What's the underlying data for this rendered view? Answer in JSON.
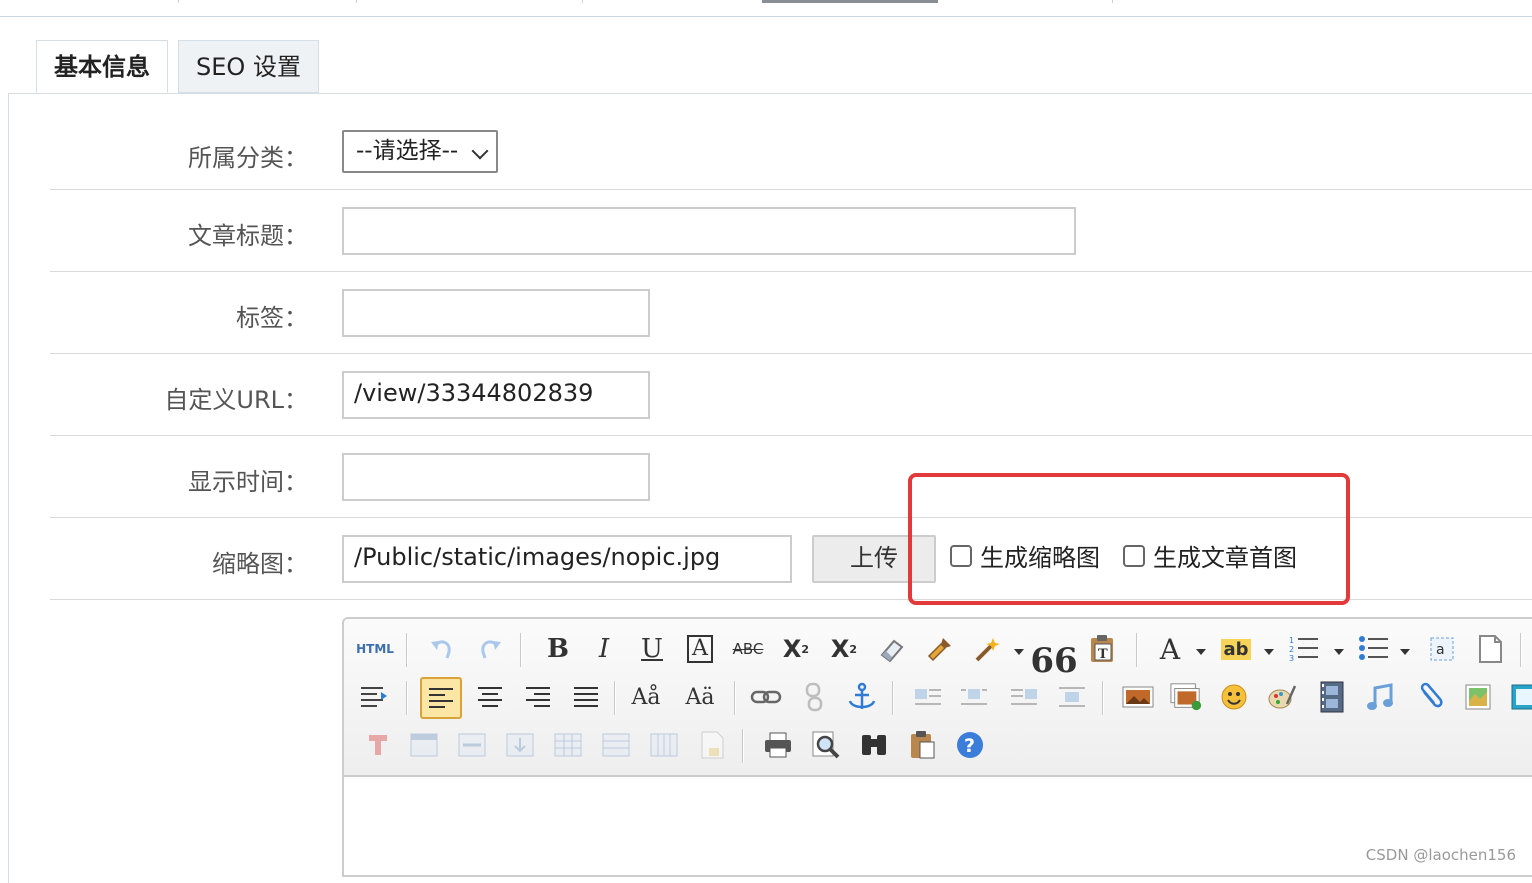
{
  "tabs": [
    {
      "label": "基本信息",
      "active": true
    },
    {
      "label": "SEO 设置",
      "active": false
    }
  ],
  "form": {
    "category": {
      "label": "所属分类：",
      "selected": "--请选择--"
    },
    "title": {
      "label": "文章标题：",
      "value": ""
    },
    "tags": {
      "label": "标签：",
      "value": ""
    },
    "custom_url": {
      "label": "自定义URL：",
      "value": "/view/33344802839"
    },
    "display_time": {
      "label": "显示时间：",
      "value": ""
    },
    "thumbnail": {
      "label": "缩略图：",
      "value": "/Public/static/images/nopic.jpg",
      "upload_label": "上传",
      "options": [
        {
          "label": "生成缩略图",
          "checked": false
        },
        {
          "label": "生成文章首图",
          "checked": false
        }
      ]
    }
  },
  "editor": {
    "toolbar_rows": [
      [
        "html-icon",
        "undo-icon",
        "redo-icon",
        "bold-icon",
        "italic-icon",
        "underline-icon",
        "font-border-icon",
        "strikethrough-icon",
        "superscript-icon",
        "subscript-icon",
        "eraser-icon",
        "format-brush-icon",
        "auto-format-icon",
        "blockquote-icon",
        "paste-text-icon",
        "font-color-icon",
        "highlight-icon",
        "ordered-list-icon",
        "unordered-list-icon",
        "select-all-icon",
        "clear-doc-icon"
      ],
      [
        "indent-icon",
        "align-left-icon",
        "align-center-icon",
        "align-right-icon",
        "align-justify-icon",
        "font-size-up-icon",
        "font-size-down-icon",
        "link-icon",
        "unlink-icon",
        "anchor-icon",
        "image-left-icon",
        "image-center-icon",
        "image-right-icon",
        "image-none-icon",
        "insert-image-icon",
        "multi-image-icon",
        "emoticon-icon",
        "scrawl-icon",
        "video-icon",
        "music-icon",
        "attachment-icon",
        "map-icon",
        "gmap-icon"
      ],
      [
        "insert-frame-icon",
        "insert-table-icon",
        "delete-table-icon",
        "insert-row-icon",
        "insert-col-icon",
        "merge-cells-icon",
        "split-cells-icon",
        "page-break-icon",
        "print-icon",
        "preview-icon",
        "search-replace-icon",
        "paste-icon",
        "help-icon"
      ]
    ]
  },
  "watermark": "CSDN @laochen156",
  "colors": {
    "highlight_border": "#e23a3a",
    "help_icon": "#3b7dd8"
  }
}
